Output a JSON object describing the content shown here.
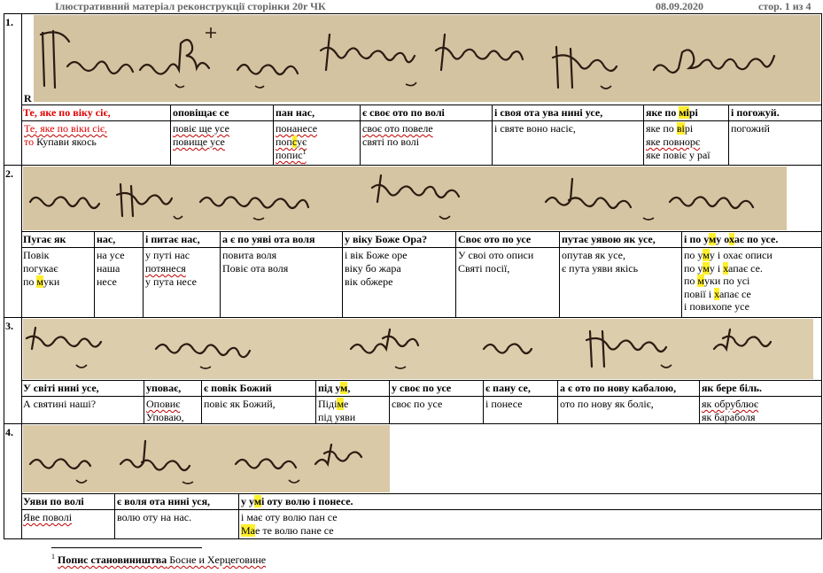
{
  "header": {
    "title": "Ілюстративний матеріал  реконструкції сторінки 20r  ЧК",
    "date": "08.09.2020",
    "page": "стор. 1 из 4"
  },
  "sections": [
    {
      "number": "1.",
      "marker": "R",
      "headers": [
        "Те, яке по віку сіє,",
        "оповіщає се",
        "пан нас,",
        "є своє ото по волі",
        "і своя ота ува нині усе,",
        "яке по мірі",
        "і погожуй."
      ],
      "cells": [
        [
          "Те, яке по віки сіє,",
          "то Купави якось"
        ],
        [
          "повіє ще усе",
          "повище усе"
        ],
        [
          "понанесе",
          "попсує",
          "попис"
        ],
        [
          "своє ото повеле",
          "святі по волі"
        ],
        [
          "і святе воно насіє,"
        ],
        [
          "яке по вірі",
          "яке повнорє",
          "яке повіє у раї"
        ],
        [
          "погожий"
        ]
      ],
      "footnote_ref": "1"
    },
    {
      "number": "2.",
      "headers": [
        "Пугає як",
        "нас,",
        "і питає нас,",
        "а є по уяві ота воля",
        "у віку Боже Ора?",
        "Своє ото по усе",
        "путає уявою як усе,",
        "і по уму охає по усе."
      ],
      "cells": [
        [
          "Повік",
          "погукає",
          "по муки"
        ],
        [
          "на усе",
          "наша",
          "несе"
        ],
        [
          "у путі нас",
          "потянеся",
          "у пута несе"
        ],
        [
          "повита воля",
          "Повіє ота воля"
        ],
        [
          "і вік Боже оре",
          "віку бо жара",
          "вік обжере"
        ],
        [
          "У своі ото описи",
          "Святі посії,"
        ],
        [
          "опутав як усе,",
          "є пута уяви якісь"
        ],
        [
          "по уму і охає описи",
          "по уму і хапає се.",
          "по муки по усі",
          "повії і хапає се",
          "і повихопе усе"
        ]
      ]
    },
    {
      "number": "3.",
      "headers": [
        "У світі нині усе,",
        "уповає,",
        "є повік Божий",
        "під ум,",
        "у своє по усе",
        "є пану се,",
        "а є ото по нову кабалою,",
        "як бере біль."
      ],
      "cells": [
        [
          "А святині наші?"
        ],
        [
          "Оповиє",
          "Уповаю,"
        ],
        [
          "повіє як Божий,"
        ],
        [
          "Підіме",
          "під уяви"
        ],
        [
          "своє по усе"
        ],
        [
          "і понесе"
        ],
        [
          "ото по нову як боліє,"
        ],
        [
          "як обрублює",
          "як бараболя"
        ]
      ]
    },
    {
      "number": "4.",
      "headers": [
        "Уяви по волі",
        "є воля ота нині уся,",
        "у умі оту волю і понесе."
      ],
      "cells": [
        [
          "Яве поволі"
        ],
        [
          "волю оту на нас."
        ],
        [
          "і має оту волю пан се",
          "Має те волю пане се"
        ]
      ]
    }
  ],
  "footnote": {
    "number": "1",
    "bold_text": "Попис становиништва",
    "text": " Босне и Херцеговине"
  },
  "colors": {
    "highlight": "#ffef2a",
    "red_text": "#e00000",
    "parchment": "#d9c9a8",
    "ink": "#2a1c12"
  }
}
